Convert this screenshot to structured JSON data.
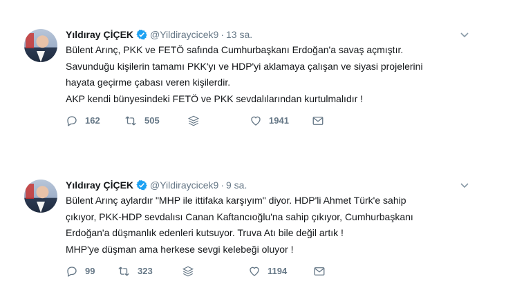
{
  "colors": {
    "verified": "#1da1f2",
    "text": "#14171a",
    "secondary": "#657786",
    "icon": "#8899a6"
  },
  "tweets": [
    {
      "author": "Yıldıray ÇİÇEK",
      "handle": "@Yildiraycicek9",
      "separator": "·",
      "time": "13 sa.",
      "lines": [
        "Bülent Arınç, PKK ve FETÖ safında Cumhurbaşkanı Erdoğan'a savaş açmıştır.",
        "Savunduğu kişilerin tamamı PKK'yı ve HDP'yi aklamaya çalışan ve siyasi projelerini",
        "hayata geçirme çabası veren kişilerdir.",
        "AKP kendi bünyesindeki FETÖ ve PKK sevdalılarından kurtulmalıdır !"
      ],
      "replies": "162",
      "retweets": "505",
      "likes": "1941"
    },
    {
      "author": "Yıldıray ÇİÇEK",
      "handle": "@Yildiraycicek9",
      "separator": "·",
      "time": "9 sa.",
      "lines": [
        "Bülent Arınç aylardır \"MHP ile ittifaka karşıyım\" diyor. HDP'li Ahmet Türk'e sahip",
        "çıkıyor, PKK-HDP sevdalısı Canan Kaftancıoğlu'na sahip çıkıyor, Cumhurbaşkanı",
        "Erdoğan'a düşmanlık edenleri kutsuyor. Truva Atı bile değil artık !",
        "MHP'ye düşman ama herkese sevgi kelebeği oluyor !"
      ],
      "replies": "99",
      "retweets": "323",
      "likes": "1194"
    }
  ]
}
